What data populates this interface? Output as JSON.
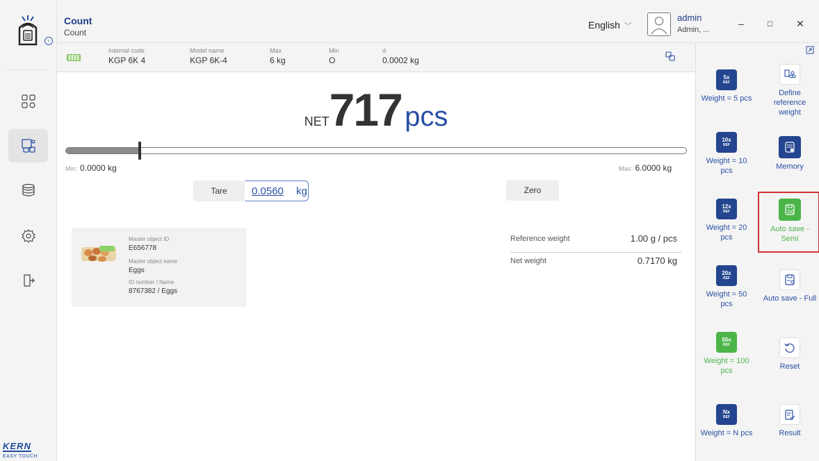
{
  "header": {
    "title": "Count",
    "subtitle": "Count",
    "language": "English",
    "user_name": "admin",
    "user_role": "Admin, ...",
    "win_minimize": "–",
    "win_maximize": "□",
    "win_close": "✕"
  },
  "brand": {
    "name": "KERN",
    "tagline": "EASY TOUCH"
  },
  "sidebar": {
    "items": [
      {
        "icon": "dashboard-grid-icon"
      },
      {
        "icon": "application-icon",
        "active": true
      },
      {
        "icon": "database-icon"
      },
      {
        "icon": "settings-gear-icon"
      },
      {
        "icon": "logout-icon"
      }
    ]
  },
  "scale_info": {
    "internal_code_label": "Internal code",
    "internal_code": "KGP 6K 4",
    "model_name_label": "Model name",
    "model_name": "KGP 6K-4",
    "max_label": "Max",
    "max": "6 kg",
    "min_label": "Min",
    "min": "O",
    "d_label": "d",
    "d": "0.0002 kg"
  },
  "display": {
    "net_label": "NET",
    "value": "717",
    "unit": "pcs",
    "bar_fill_fraction": 0.12,
    "min_prefix": "Min:",
    "min_value": "0.0000 kg",
    "max_prefix": "Max:",
    "max_value": "6.0000 kg"
  },
  "controls": {
    "tare_label": "Tare",
    "tare_value": "0.0560",
    "tare_unit": "kg",
    "zero_label": "Zero"
  },
  "master_object": {
    "id_label": "Master object ID",
    "id": "E656778",
    "name_label": "Master object name",
    "name": "Eggs",
    "idname_label": "ID number / Name",
    "idname": "8767382 / Eggs"
  },
  "details": {
    "reference_weight_label": "Reference weight",
    "reference_weight": "1.00 g / pcs",
    "net_weight_label": "Net weight",
    "net_weight": "0.7170 kg"
  },
  "right_panel": {
    "ref5": {
      "tile": "5x",
      "ref": "REF",
      "caption": "Weight = 5 pcs"
    },
    "ref10": {
      "tile": "10x",
      "ref": "REF",
      "caption": "Weight = 10 pcs"
    },
    "ref20": {
      "tile": "12x",
      "ref": "REF",
      "caption": "Weight = 20 pcs"
    },
    "ref50": {
      "tile": "20x",
      "ref": "REF",
      "caption": "Weight = 50 pcs"
    },
    "ref100": {
      "tile": "50x",
      "ref": "REF",
      "caption": "Weight = 100 pcs"
    },
    "refN": {
      "tile": "Nx",
      "ref": "REF",
      "caption": "Weight = N pcs"
    },
    "define_ref": "Define reference weight",
    "memory": "Memory",
    "auto_semi": "Auto save - Semi",
    "auto_full": "Auto save - Full",
    "reset": "Reset",
    "result": "Result"
  },
  "colors": {
    "brand_blue": "#24458f",
    "accent_green": "#4cb54a",
    "highlight_red": "#d32f2f"
  }
}
